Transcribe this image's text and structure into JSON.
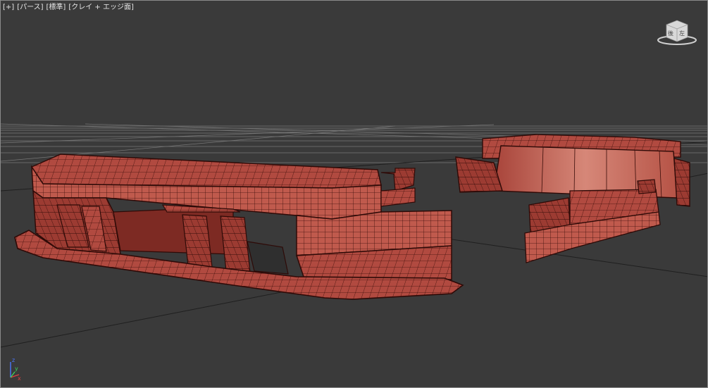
{
  "viewport": {
    "label_plus": "[+]",
    "label_view": "[パース]",
    "label_shading": "[標準]",
    "label_style": "[クレイ + エッジ面]"
  },
  "viewcube": {
    "face_left": "後",
    "face_right": "左"
  },
  "axis": {
    "x_label": "x",
    "y_label": "y",
    "z_label": "z"
  },
  "colors": {
    "background": "#3a3a3a",
    "grid": "#8c8c8c",
    "mesh_fill": "#b14a40",
    "mesh_shade": "#8a2f28",
    "mesh_light": "#d06a5c",
    "wire": "#3a0d09"
  },
  "icons": {
    "viewcube": "viewcube-icon",
    "axis": "axis-tripod-icon"
  }
}
